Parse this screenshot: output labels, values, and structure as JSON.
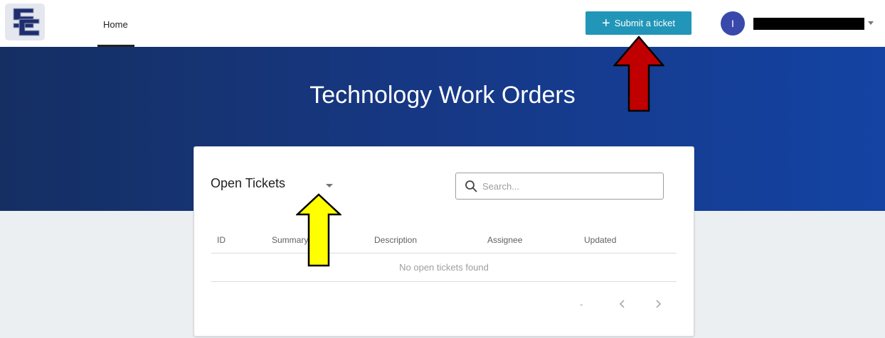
{
  "header": {
    "logo_text": "SC",
    "nav": {
      "home_label": "Home"
    },
    "submit_button": {
      "icon": "plus-icon",
      "label": "Submit a ticket"
    },
    "user": {
      "avatar_initial": "I",
      "name_redacted": "",
      "menu_icon": "chevron-down-icon"
    }
  },
  "hero": {
    "title": "Technology Work Orders"
  },
  "tickets": {
    "filter": {
      "selected": "Open Tickets",
      "icon": "chevron-down-icon"
    },
    "search": {
      "placeholder": "Search...",
      "value": "",
      "icon": "search-icon"
    },
    "columns": [
      "ID",
      "Summary",
      "Description",
      "Assignee",
      "Updated"
    ],
    "empty_message": "No open tickets found",
    "pagination": {
      "range": "-",
      "prev_icon": "chevron-left-icon",
      "next_icon": "chevron-right-icon"
    }
  },
  "annotations": [
    {
      "shape": "arrow-up",
      "color": "#c00000",
      "target": "submit-ticket-button"
    },
    {
      "shape": "arrow-up",
      "color": "#ffff00",
      "target": "ticket-filter-dropdown"
    }
  ],
  "colors": {
    "accent": "#2196b8",
    "hero_dark": "#152f63",
    "hero_light": "#1443a3",
    "avatar": "#3949ab",
    "page_background": "#eceff1"
  }
}
